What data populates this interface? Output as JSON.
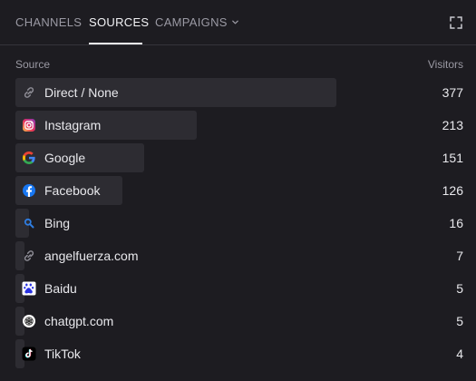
{
  "tabs": [
    {
      "label": "CHANNELS",
      "active": false
    },
    {
      "label": "SOURCES",
      "active": true
    },
    {
      "label": "CAMPAIGNS",
      "active": false
    }
  ],
  "table": {
    "source_header": "Source",
    "visitors_header": "Visitors",
    "max_visitors": 377,
    "rows": [
      {
        "label": "Direct / None",
        "value": "377",
        "visitors": 377,
        "icon": "link-icon"
      },
      {
        "label": "Instagram",
        "value": "213",
        "visitors": 213,
        "icon": "instagram-icon"
      },
      {
        "label": "Google",
        "value": "151",
        "visitors": 151,
        "icon": "google-icon"
      },
      {
        "label": "Facebook",
        "value": "126",
        "visitors": 126,
        "icon": "facebook-icon"
      },
      {
        "label": "Bing",
        "value": "16",
        "visitors": 16,
        "icon": "bing-icon"
      },
      {
        "label": "angelfuerza.com",
        "value": "7",
        "visitors": 7,
        "icon": "link-icon"
      },
      {
        "label": "Baidu",
        "value": "5",
        "visitors": 5,
        "icon": "baidu-icon"
      },
      {
        "label": "chatgpt.com",
        "value": "5",
        "visitors": 5,
        "icon": "chatgpt-icon"
      },
      {
        "label": "TikTok",
        "value": "4",
        "visitors": 4,
        "icon": "tiktok-icon"
      }
    ]
  },
  "colors": {
    "background": "#1d1c21",
    "bar": "#2d2c32",
    "text": "#e8e8ec",
    "muted": "#9a99a3"
  }
}
